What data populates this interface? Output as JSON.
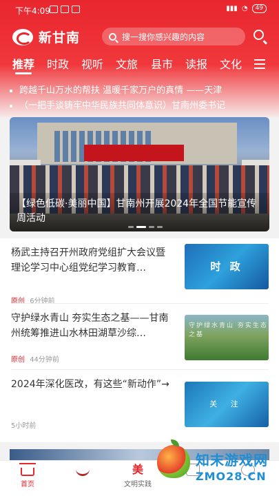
{
  "status_bar": {
    "time": "下午4:09",
    "battery": "49"
  },
  "header": {
    "app_name": "新甘南",
    "search_placeholder": "搜一搜你感兴趣的内容"
  },
  "tabs": [
    "推荐",
    "时政",
    "视听",
    "文旅",
    "县市",
    "读报",
    "文化"
  ],
  "active_tab": "推荐",
  "ticker": [
    "跨越千山万水的帮扶 温暖千家万户的真情 ——天津",
    "（一把手谈铸牢中华民族共同体意识）甘南州委书记"
  ],
  "banner": {
    "caption": "【绿色低碳·美丽中国】甘南州开展2024年全国节能宣传周活动",
    "slide_count": 4,
    "active_slide": 2
  },
  "news": [
    {
      "title": "杨武主持召开州政府党组扩大会议暨理论学习中心组党纪学习教育…",
      "badge": "原创",
      "time": "6分钟前",
      "thumb_label": "时 政"
    },
    {
      "title": "守护绿水青山 夯实生态之基——甘南州统筹推进山水林田湖草沙综…",
      "badge": "原创",
      "time": "44分钟前",
      "thumb_label": "守护绿水青山 夯实生态之基"
    },
    {
      "title": "2024年深化医改，有这些“新动作”→",
      "badge": "",
      "time": "5小时前",
      "thumb_label": "关 注"
    }
  ],
  "bottom_nav": [
    "首页",
    "",
    "文明实践",
    "",
    ""
  ],
  "watermark": {
    "text": "知末游戏网",
    "url": "ZMO28.CN"
  },
  "colors": {
    "brand_red": "#e8262e",
    "text_dark": "#333333",
    "meta_gray": "#999999"
  }
}
